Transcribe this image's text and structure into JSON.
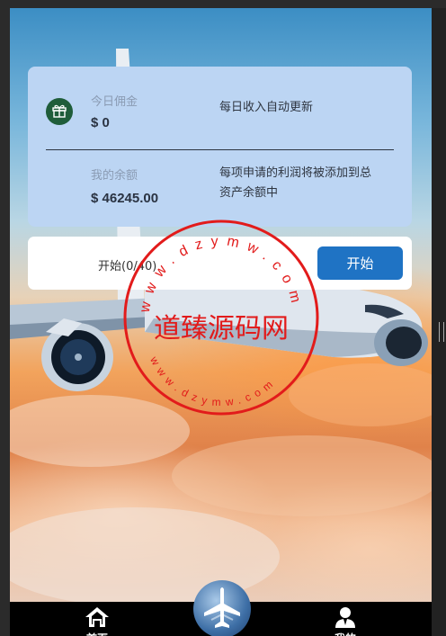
{
  "stats_card": {
    "today_commission_label": "今日佣金",
    "today_commission_value": "$ 0",
    "today_note": "每日收入自动更新",
    "balance_label": "我的余额",
    "balance_value": "$ 46245.00",
    "balance_note_line1": "每项申请的利润将被添加到总",
    "balance_note_line2": "资产余额中"
  },
  "action_card": {
    "progress_text": "开始(0/40)",
    "start_button_label": "开始"
  },
  "bottom_nav": {
    "home_label": "首页",
    "mine_label": "我的"
  },
  "watermark": {
    "text": "道臻源码网",
    "url_text": "www.dzymw.com"
  },
  "colors": {
    "stats_card_bg": "#bcd5f3",
    "start_button_bg": "#1f73c4",
    "stamp_red": "#e21b1b",
    "nav_bg": "#000000"
  },
  "icons": [
    "gift-icon",
    "home-icon",
    "airplane-icon",
    "user-icon"
  ]
}
